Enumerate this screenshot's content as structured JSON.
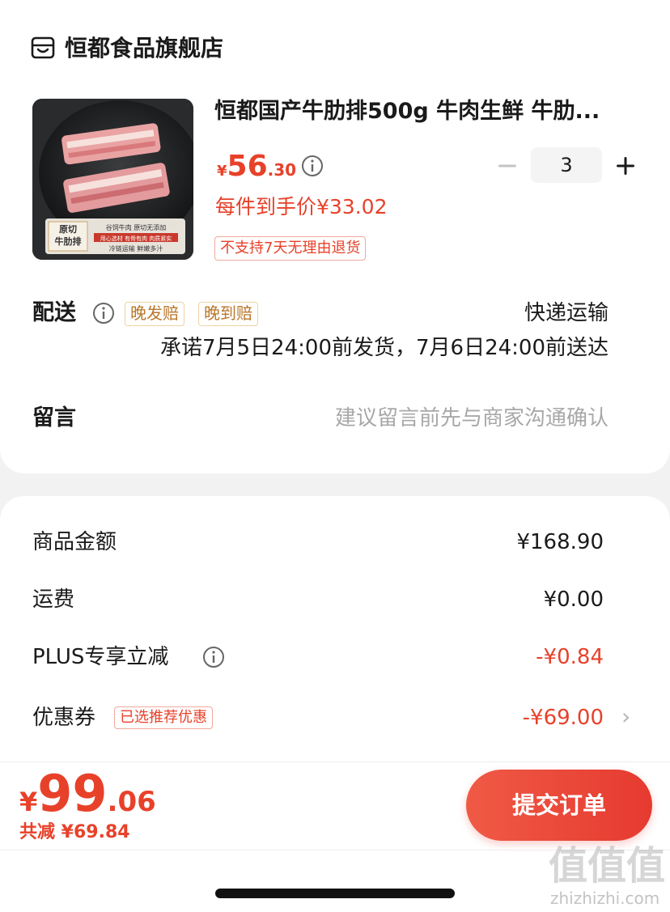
{
  "store": {
    "name": "恒都食品旗舰店",
    "icon": "shop-icon"
  },
  "product": {
    "title": "恒都国产牛肋排500g 牛肉生鲜 牛肋...",
    "price_symbol": "¥",
    "price_int": "56",
    "price_dec": ".30",
    "quantity": "3",
    "unit_price_text": "每件到手价¥33.02",
    "return_tag": "不支持7天无理由退货",
    "image_text": {
      "badge1": "原切",
      "badge2": "牛肋排",
      "line1": "谷饲牛肉 原切无添加",
      "line2": "用心选材 有骨有肉 肉质紧实",
      "line3": "冷链运输 鲜嫩多汁"
    }
  },
  "delivery": {
    "label": "配送",
    "tag1": "晚发赔",
    "tag2": "晚到赔",
    "method": "快递运输",
    "promise": "承诺7月5日24:00前发货，7月6日24:00前送达"
  },
  "memo": {
    "label": "留言",
    "placeholder": "建议留言前先与商家沟通确认"
  },
  "summary": {
    "goods_label": "商品金额",
    "goods_value": "¥168.90",
    "shipping_label": "运费",
    "shipping_value": "¥0.00",
    "plus_label": "PLUS专享立减",
    "plus_value": "-¥0.84",
    "coupon_label": "优惠券",
    "coupon_tag": "已选推荐优惠",
    "coupon_value": "-¥69.00",
    "coupon_chevron": "›"
  },
  "footer": {
    "total_symbol": "¥",
    "total_int": "99",
    "total_dec": ".06",
    "saved_text": "共减 ¥69.84",
    "submit_label": "提交订单"
  },
  "watermark": {
    "main": "值值值",
    "url": "zhizhizhi.com"
  },
  "colors": {
    "accent": "#e8412a",
    "tag_orange": "#b8772a"
  }
}
